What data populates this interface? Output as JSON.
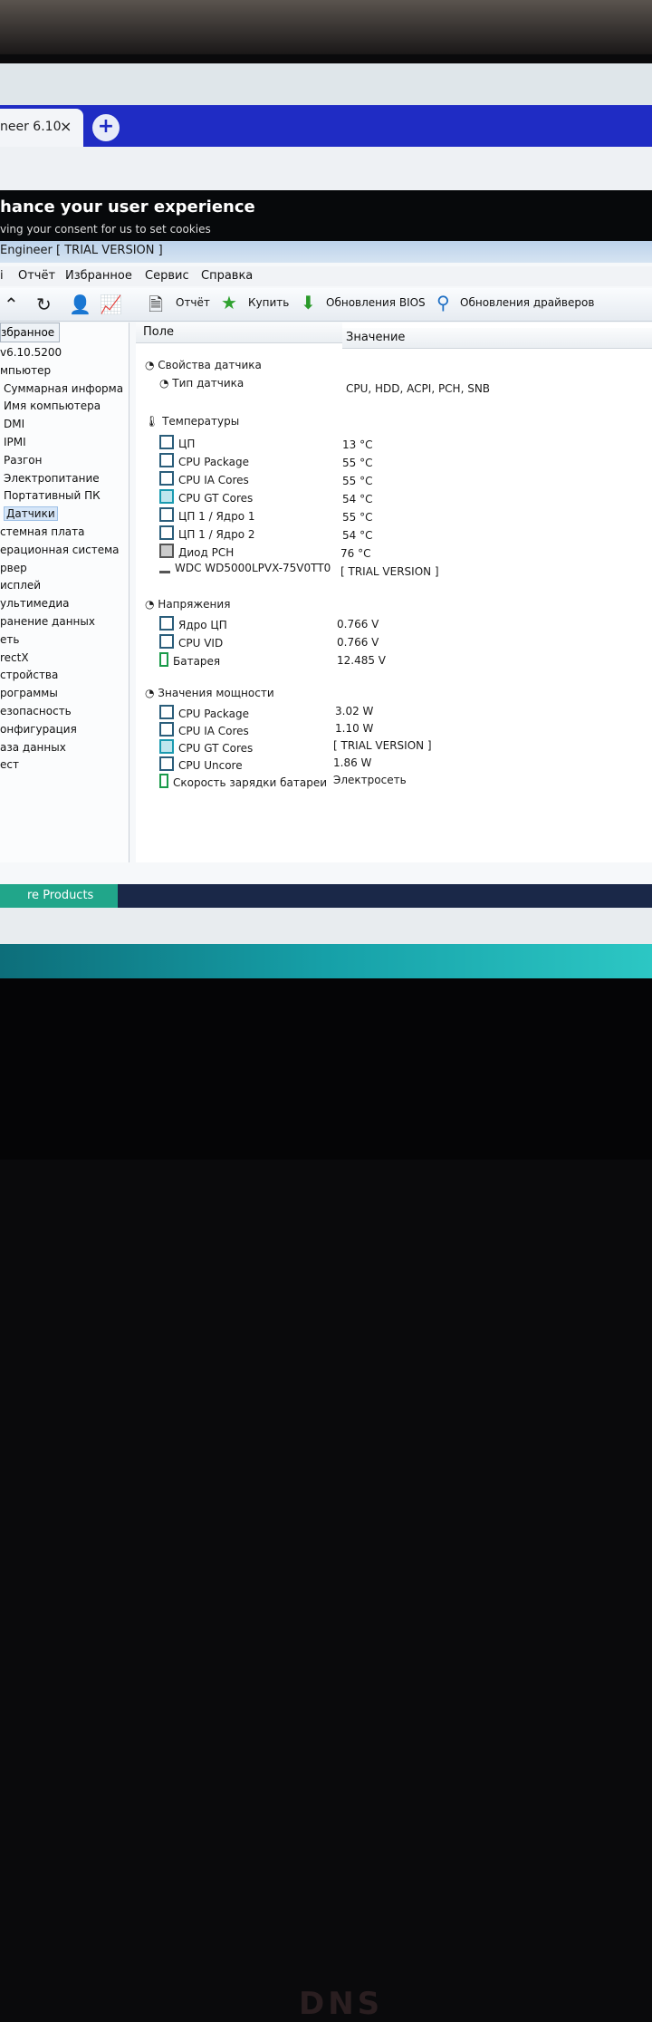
{
  "browser": {
    "tab_title": "neer 6.10",
    "tab_close": "×",
    "new_tab": "+",
    "cookie_title": "hance your user experience",
    "cookie_sub": "ving your consent for us to set cookies"
  },
  "app": {
    "title": "Engineer  [ TRIAL VERSION ]",
    "menu": [
      "Отчёт",
      "Избранное",
      "Сервис",
      "Справка"
    ],
    "toolbar_buttons": [
      "Отчёт",
      "Купить",
      "Обновления BIOS",
      "Обновления драйверов"
    ]
  },
  "sidebar": {
    "header": "збранное",
    "items": [
      "v6.10.5200",
      "мпьютер",
      "Суммарная информа",
      "Имя компьютера",
      "DMI",
      "IPMI",
      "Разгон",
      "Электропитание",
      "Портативный ПК",
      "Датчики",
      "стемная плата",
      "ерационная система",
      "рвер",
      "исплей",
      "ультимедиа",
      "ранение данных",
      "еть",
      "rectX",
      "стройства",
      "рограммы",
      "езопасность",
      "онфигурация",
      "аза данных",
      "ест"
    ]
  },
  "grid": {
    "col_field": "Поле",
    "col_value": "Значение",
    "sensor_props": {
      "title": "Свойства датчика",
      "rows": [
        {
          "name": "Тип датчика",
          "value": "CPU, HDD, ACPI, PCH, SNB"
        }
      ]
    },
    "temperatures": {
      "title": "Температуры",
      "rows": [
        {
          "name": "ЦП",
          "value": "13 °C"
        },
        {
          "name": "CPU Package",
          "value": "55 °C"
        },
        {
          "name": "CPU IA Cores",
          "value": "55 °C"
        },
        {
          "name": "CPU GT Cores",
          "value": "54 °C"
        },
        {
          "name": "ЦП 1 / Ядро 1",
          "value": "55 °C"
        },
        {
          "name": "ЦП 1 / Ядро 2",
          "value": "54 °C"
        },
        {
          "name": "Диод PCH",
          "value": "76 °C"
        },
        {
          "name": "WDC WD5000LPVX-75V0TT0",
          "value": "[ TRIAL VERSION ]"
        }
      ]
    },
    "voltages": {
      "title": "Напряжения",
      "rows": [
        {
          "name": "Ядро ЦП",
          "value": "0.766 V"
        },
        {
          "name": "CPU VID",
          "value": "0.766 V"
        },
        {
          "name": "Батарея",
          "value": "12.485 V"
        }
      ]
    },
    "power": {
      "title": "Значения мощности",
      "rows": [
        {
          "name": "CPU Package",
          "value": "3.02 W"
        },
        {
          "name": "CPU IA Cores",
          "value": "1.10 W"
        },
        {
          "name": "CPU GT Cores",
          "value": "[ TRIAL VERSION ]"
        },
        {
          "name": "CPU Uncore",
          "value": "1.86 W"
        },
        {
          "name": "Скорость зарядки батареи",
          "value": "Электросеть"
        }
      ]
    }
  },
  "footer": {
    "bottom_tab": "re Products"
  },
  "brand": "DNS"
}
